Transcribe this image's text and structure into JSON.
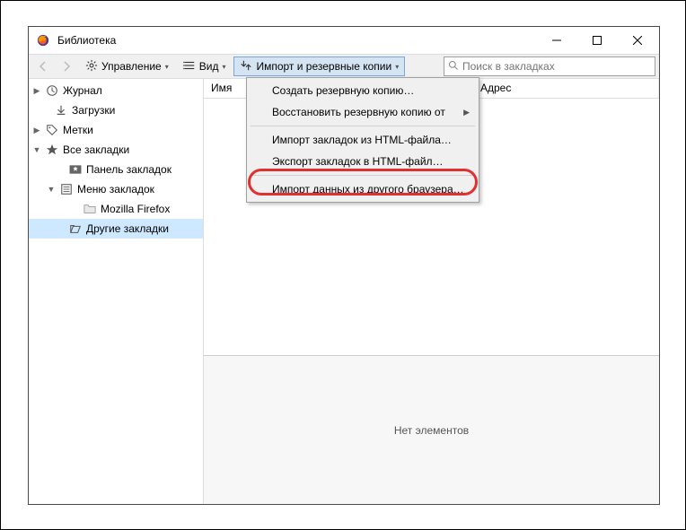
{
  "window": {
    "title": "Библиотека"
  },
  "toolbar": {
    "back_disabled": true,
    "forward_disabled": true,
    "manage_label": "Управление",
    "view_label": "Вид",
    "import_label": "Импорт и резервные копии"
  },
  "search": {
    "placeholder": "Поиск в закладках"
  },
  "sidebar": {
    "items": [
      {
        "label": "Журнал",
        "indent": 4,
        "twisty": "▶",
        "icon": "clock"
      },
      {
        "label": "Загрузки",
        "indent": 14,
        "twisty": "",
        "icon": "download"
      },
      {
        "label": "Метки",
        "indent": 4,
        "twisty": "▶",
        "icon": "tag"
      },
      {
        "label": "Все закладки",
        "indent": 4,
        "twisty": "▼",
        "icon": "star"
      },
      {
        "label": "Панель закладок",
        "indent": 30,
        "twisty": "",
        "icon": "bookmark-bar"
      },
      {
        "label": "Меню закладок",
        "indent": 20,
        "twisty": "▼",
        "icon": "bookmark-menu"
      },
      {
        "label": "Mozilla Firefox",
        "indent": 46,
        "twisty": "",
        "icon": "folder"
      },
      {
        "label": "Другие закладки",
        "indent": 30,
        "twisty": "",
        "icon": "other-bookmarks",
        "sel": true
      }
    ]
  },
  "columns": {
    "name": "Имя",
    "address": "Адрес"
  },
  "dropdown": {
    "items": [
      {
        "label": "Создать резервную копию…",
        "sep_after": false
      },
      {
        "label": "Восстановить резервную копию от",
        "submenu": true,
        "sep_after": true
      },
      {
        "label": "Импорт закладок из HTML-файла…",
        "sep_after": false
      },
      {
        "label": "Экспорт закладок в HTML-файл…",
        "sep_after": true
      },
      {
        "label_pre": "Им",
        "label_u": "п",
        "label_post": "орт данных из другого браузера…",
        "sep_after": false
      }
    ]
  },
  "detail": {
    "empty": "Нет элементов"
  }
}
